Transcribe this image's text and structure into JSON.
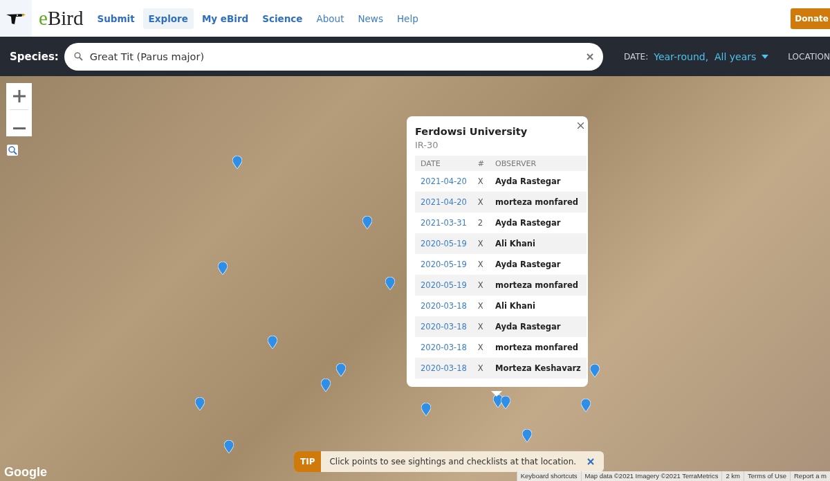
{
  "header": {
    "brand": "eBird",
    "nav": [
      {
        "label": "Submit",
        "selected": false,
        "primary": true
      },
      {
        "label": "Explore",
        "selected": true,
        "primary": true
      },
      {
        "label": "My eBird",
        "selected": false,
        "primary": true
      },
      {
        "label": "Science",
        "selected": false,
        "primary": true
      },
      {
        "label": "About",
        "selected": false,
        "primary": false
      },
      {
        "label": "News",
        "selected": false,
        "primary": false
      },
      {
        "label": "Help",
        "selected": false,
        "primary": false
      }
    ],
    "donate": "Donate"
  },
  "filter_bar": {
    "species_label": "Species:",
    "species_value": "Great Tit (Parus major)",
    "date_label": "DATE:",
    "date_value": "Year-round,  All years",
    "location_label": "LOCATION"
  },
  "popup": {
    "title": "Ferdowsi University",
    "subtitle": "IR-30",
    "columns": [
      "DATE",
      "#",
      "OBSERVER"
    ],
    "rows": [
      {
        "date": "2021-04-20",
        "count": "X",
        "observer": "Ayda Rastegar"
      },
      {
        "date": "2021-04-20",
        "count": "X",
        "observer": "morteza monfared"
      },
      {
        "date": "2021-03-31",
        "count": "2",
        "observer": "Ayda Rastegar"
      },
      {
        "date": "2020-05-19",
        "count": "X",
        "observer": "Ali Khani"
      },
      {
        "date": "2020-05-19",
        "count": "X",
        "observer": "Ayda Rastegar"
      },
      {
        "date": "2020-05-19",
        "count": "X",
        "observer": "morteza monfared"
      },
      {
        "date": "2020-03-18",
        "count": "X",
        "observer": "Ali Khani"
      },
      {
        "date": "2020-03-18",
        "count": "X",
        "observer": "Ayda Rastegar"
      },
      {
        "date": "2020-03-18",
        "count": "X",
        "observer": "morteza monfared"
      },
      {
        "date": "2020-03-18",
        "count": "X",
        "observer": "Morteza Keshavarz"
      }
    ]
  },
  "tip": {
    "badge": "TIP",
    "text": "Click points to see sightings and checklists at that location."
  },
  "map_footer": {
    "logo": "Google",
    "links": [
      "Keyboard shortcuts",
      "Map data ©2021 Imagery ©2021 TerraMetrics",
      "2 km",
      "Terms of Use",
      "Report a m"
    ]
  }
}
